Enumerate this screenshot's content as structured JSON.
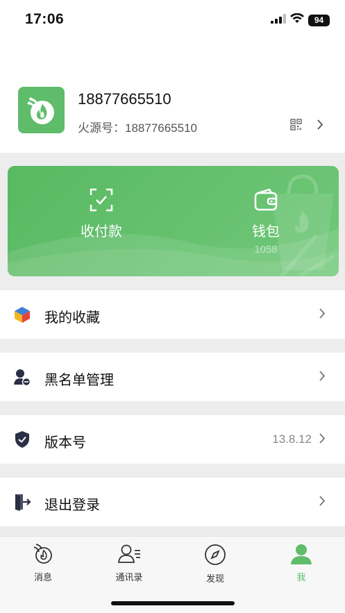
{
  "status_bar": {
    "time": "17:06",
    "battery": "94"
  },
  "profile": {
    "name": "18877665510",
    "id_text": "火源号：18877665510"
  },
  "wallet_card": {
    "pay_label": "收付款",
    "wallet_label": "钱包",
    "wallet_balance": "1058"
  },
  "menu": {
    "favorites": {
      "label": "我的收藏"
    },
    "blacklist": {
      "label": "黑名单管理"
    },
    "version": {
      "label": "版本号",
      "value": "13.8.12"
    },
    "logout": {
      "label": "退出登录"
    }
  },
  "tabs": [
    {
      "label": "消息",
      "icon": "flame-chat-icon"
    },
    {
      "label": "通讯录",
      "icon": "contacts-icon"
    },
    {
      "label": "发现",
      "icon": "compass-icon"
    },
    {
      "label": "我",
      "icon": "person-icon"
    }
  ],
  "colors": {
    "accent": "#5fbc6a",
    "card_green": "#62be6c",
    "background": "#ededed"
  }
}
